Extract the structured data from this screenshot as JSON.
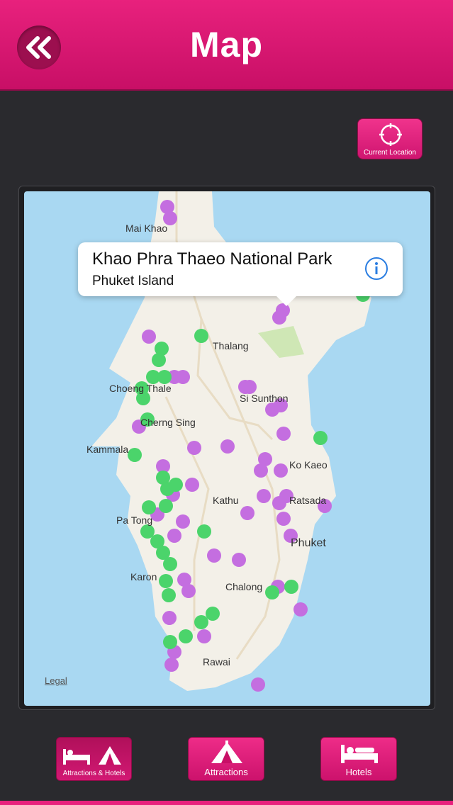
{
  "header": {
    "title": "Map",
    "back_icon": "double-chevron-left-icon"
  },
  "current_location": {
    "label": "Current Location",
    "icon": "crosshair-icon"
  },
  "callout": {
    "title": "Khao Phra Thaeo National Park",
    "subtitle": "Phuket Island",
    "icon": "info-icon"
  },
  "map": {
    "legal": "Legal",
    "places": [
      "Mai Khao",
      "Thalang",
      "Choeng Thale",
      "Si Sunthon",
      "Cherng Sing",
      "Kammala",
      "Ko Kaeo",
      "Kathu",
      "Ratsada",
      "Pa Tong",
      "Phuket",
      "Karon",
      "Chalong",
      "Rawai"
    ],
    "colors": {
      "attraction_pin": "#c46ee0",
      "hotel_pin": "#4bd46b",
      "land": "#f3f0e8",
      "water": "#a9d8f2",
      "park": "#cfe7b5"
    }
  },
  "tabs": [
    {
      "label": "Attractions & Hotels",
      "active": true
    },
    {
      "label": "Attractions",
      "active": false
    },
    {
      "label": "Hotels",
      "active": false
    }
  ],
  "accent": "#e8217d"
}
